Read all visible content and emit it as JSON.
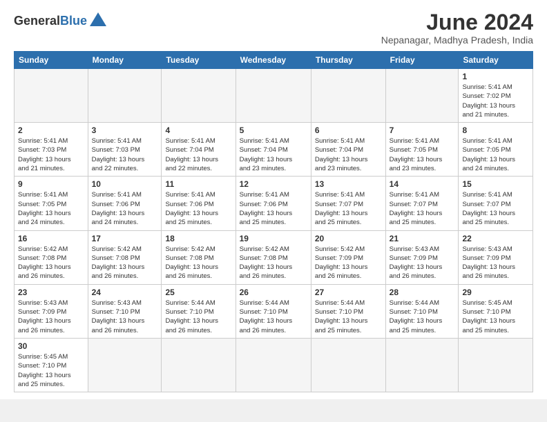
{
  "header": {
    "logo_general": "General",
    "logo_blue": "Blue",
    "month_title": "June 2024",
    "location": "Nepanagar, Madhya Pradesh, India"
  },
  "days_of_week": [
    "Sunday",
    "Monday",
    "Tuesday",
    "Wednesday",
    "Thursday",
    "Friday",
    "Saturday"
  ],
  "weeks": [
    [
      {
        "day": "",
        "info": ""
      },
      {
        "day": "",
        "info": ""
      },
      {
        "day": "",
        "info": ""
      },
      {
        "day": "",
        "info": ""
      },
      {
        "day": "",
        "info": ""
      },
      {
        "day": "",
        "info": ""
      },
      {
        "day": "1",
        "info": "Sunrise: 5:41 AM\nSunset: 7:02 PM\nDaylight: 13 hours\nand 21 minutes."
      }
    ],
    [
      {
        "day": "2",
        "info": "Sunrise: 5:41 AM\nSunset: 7:03 PM\nDaylight: 13 hours\nand 21 minutes."
      },
      {
        "day": "3",
        "info": "Sunrise: 5:41 AM\nSunset: 7:03 PM\nDaylight: 13 hours\nand 22 minutes."
      },
      {
        "day": "4",
        "info": "Sunrise: 5:41 AM\nSunset: 7:04 PM\nDaylight: 13 hours\nand 22 minutes."
      },
      {
        "day": "5",
        "info": "Sunrise: 5:41 AM\nSunset: 7:04 PM\nDaylight: 13 hours\nand 23 minutes."
      },
      {
        "day": "6",
        "info": "Sunrise: 5:41 AM\nSunset: 7:04 PM\nDaylight: 13 hours\nand 23 minutes."
      },
      {
        "day": "7",
        "info": "Sunrise: 5:41 AM\nSunset: 7:05 PM\nDaylight: 13 hours\nand 23 minutes."
      },
      {
        "day": "8",
        "info": "Sunrise: 5:41 AM\nSunset: 7:05 PM\nDaylight: 13 hours\nand 24 minutes."
      }
    ],
    [
      {
        "day": "9",
        "info": "Sunrise: 5:41 AM\nSunset: 7:05 PM\nDaylight: 13 hours\nand 24 minutes."
      },
      {
        "day": "10",
        "info": "Sunrise: 5:41 AM\nSunset: 7:06 PM\nDaylight: 13 hours\nand 24 minutes."
      },
      {
        "day": "11",
        "info": "Sunrise: 5:41 AM\nSunset: 7:06 PM\nDaylight: 13 hours\nand 25 minutes."
      },
      {
        "day": "12",
        "info": "Sunrise: 5:41 AM\nSunset: 7:06 PM\nDaylight: 13 hours\nand 25 minutes."
      },
      {
        "day": "13",
        "info": "Sunrise: 5:41 AM\nSunset: 7:07 PM\nDaylight: 13 hours\nand 25 minutes."
      },
      {
        "day": "14",
        "info": "Sunrise: 5:41 AM\nSunset: 7:07 PM\nDaylight: 13 hours\nand 25 minutes."
      },
      {
        "day": "15",
        "info": "Sunrise: 5:41 AM\nSunset: 7:07 PM\nDaylight: 13 hours\nand 25 minutes."
      }
    ],
    [
      {
        "day": "16",
        "info": "Sunrise: 5:42 AM\nSunset: 7:08 PM\nDaylight: 13 hours\nand 26 minutes."
      },
      {
        "day": "17",
        "info": "Sunrise: 5:42 AM\nSunset: 7:08 PM\nDaylight: 13 hours\nand 26 minutes."
      },
      {
        "day": "18",
        "info": "Sunrise: 5:42 AM\nSunset: 7:08 PM\nDaylight: 13 hours\nand 26 minutes."
      },
      {
        "day": "19",
        "info": "Sunrise: 5:42 AM\nSunset: 7:08 PM\nDaylight: 13 hours\nand 26 minutes."
      },
      {
        "day": "20",
        "info": "Sunrise: 5:42 AM\nSunset: 7:09 PM\nDaylight: 13 hours\nand 26 minutes."
      },
      {
        "day": "21",
        "info": "Sunrise: 5:43 AM\nSunset: 7:09 PM\nDaylight: 13 hours\nand 26 minutes."
      },
      {
        "day": "22",
        "info": "Sunrise: 5:43 AM\nSunset: 7:09 PM\nDaylight: 13 hours\nand 26 minutes."
      }
    ],
    [
      {
        "day": "23",
        "info": "Sunrise: 5:43 AM\nSunset: 7:09 PM\nDaylight: 13 hours\nand 26 minutes."
      },
      {
        "day": "24",
        "info": "Sunrise: 5:43 AM\nSunset: 7:10 PM\nDaylight: 13 hours\nand 26 minutes."
      },
      {
        "day": "25",
        "info": "Sunrise: 5:44 AM\nSunset: 7:10 PM\nDaylight: 13 hours\nand 26 minutes."
      },
      {
        "day": "26",
        "info": "Sunrise: 5:44 AM\nSunset: 7:10 PM\nDaylight: 13 hours\nand 26 minutes."
      },
      {
        "day": "27",
        "info": "Sunrise: 5:44 AM\nSunset: 7:10 PM\nDaylight: 13 hours\nand 25 minutes."
      },
      {
        "day": "28",
        "info": "Sunrise: 5:44 AM\nSunset: 7:10 PM\nDaylight: 13 hours\nand 25 minutes."
      },
      {
        "day": "29",
        "info": "Sunrise: 5:45 AM\nSunset: 7:10 PM\nDaylight: 13 hours\nand 25 minutes."
      }
    ],
    [
      {
        "day": "30",
        "info": "Sunrise: 5:45 AM\nSunset: 7:10 PM\nDaylight: 13 hours\nand 25 minutes."
      },
      {
        "day": "",
        "info": ""
      },
      {
        "day": "",
        "info": ""
      },
      {
        "day": "",
        "info": ""
      },
      {
        "day": "",
        "info": ""
      },
      {
        "day": "",
        "info": ""
      },
      {
        "day": "",
        "info": ""
      }
    ]
  ]
}
